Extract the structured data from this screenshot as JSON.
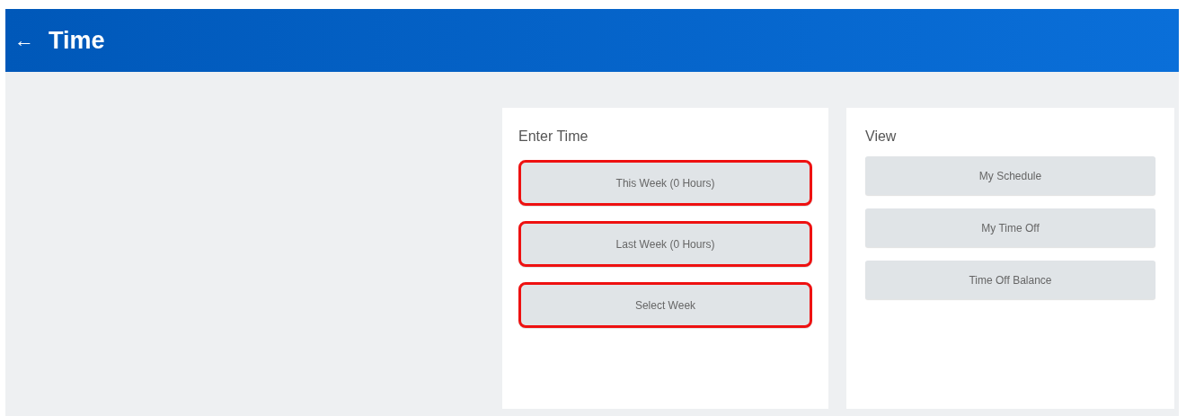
{
  "header": {
    "back": "←",
    "title": "Time"
  },
  "panels": [
    {
      "title": "Enter Time",
      "buttons": [
        {
          "label": "This Week (0 Hours)",
          "highlighted": true
        },
        {
          "label": "Last Week (0 Hours)",
          "highlighted": true
        },
        {
          "label": "Select Week",
          "highlighted": true
        }
      ]
    },
    {
      "title": "View",
      "buttons": [
        {
          "label": "My Schedule",
          "highlighted": false
        },
        {
          "label": "My Time Off",
          "highlighted": false
        },
        {
          "label": "Time Off Balance",
          "highlighted": false
        }
      ]
    }
  ]
}
